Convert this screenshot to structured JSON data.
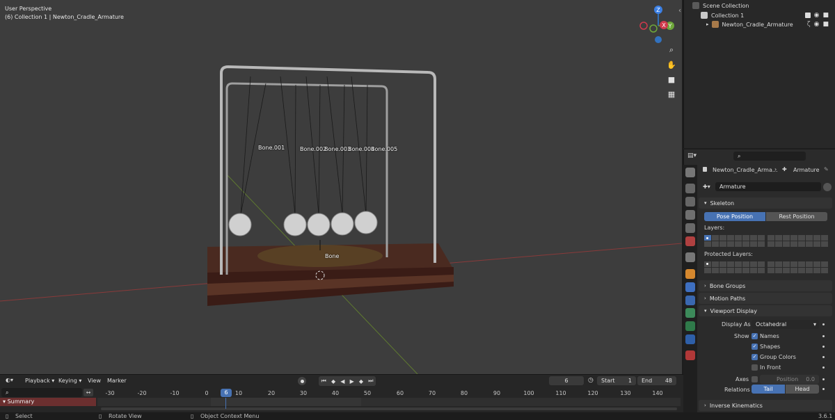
{
  "viewport": {
    "view_name": "User Perspective",
    "context": "(6) Collection 1 | Newton_Cradle_Armature",
    "bones": [
      {
        "label": "Bone.001"
      },
      {
        "label": "Bone.002"
      },
      {
        "label": "Bone.003"
      },
      {
        "label": "Bone.004"
      },
      {
        "label": "Bone.005"
      },
      {
        "label": "Bone"
      }
    ],
    "gizmo": {
      "x": "X",
      "y": "Y",
      "z": "Z"
    },
    "tools": [
      "zoom-icon",
      "hand-icon",
      "camera-icon",
      "grid-icon"
    ]
  },
  "outliner": {
    "scene_collection": "Scene Collection",
    "collection": "Collection 1",
    "object": "Newton_Cradle_Armature"
  },
  "properties": {
    "breadcrumb_object": "Newton_Cradle_Arma...",
    "breadcrumb_data": "Armature",
    "datablock_name": "Armature",
    "skeleton": {
      "title": "Skeleton",
      "pose_position": "Pose Position",
      "rest_position": "Rest Position",
      "layers_label": "Layers:",
      "protected_label": "Protected Layers:"
    },
    "bone_groups": "Bone Groups",
    "motion_paths": "Motion Paths",
    "viewport_display": {
      "title": "Viewport Display",
      "display_as_label": "Display As",
      "display_as_value": "Octahedral",
      "show_label": "Show",
      "names": "Names",
      "shapes": "Shapes",
      "group_colors": "Group Colors",
      "in_front": "In Front",
      "axes_label": "Axes",
      "position_label": "Position",
      "position_value": "0.0",
      "relations_label": "Relations",
      "tail": "Tail",
      "head": "Head"
    },
    "inverse_kinematics": "Inverse Kinematics"
  },
  "timeline": {
    "menus": [
      "Playback",
      "Keying",
      "View",
      "Marker"
    ],
    "current_frame": "6",
    "start_label": "Start",
    "start_value": "1",
    "end_label": "End",
    "end_value": "48",
    "summary": "Summary",
    "ticks": [
      "-30",
      "-20",
      "-10",
      "0",
      "10",
      "20",
      "30",
      "40",
      "50",
      "60",
      "70",
      "80",
      "90",
      "100",
      "110",
      "120",
      "130",
      "140"
    ],
    "playhead": "6"
  },
  "statusbar": {
    "select": "Select",
    "rotate": "Rotate View",
    "context_menu": "Object Context Menu",
    "version": "3.6.1"
  }
}
